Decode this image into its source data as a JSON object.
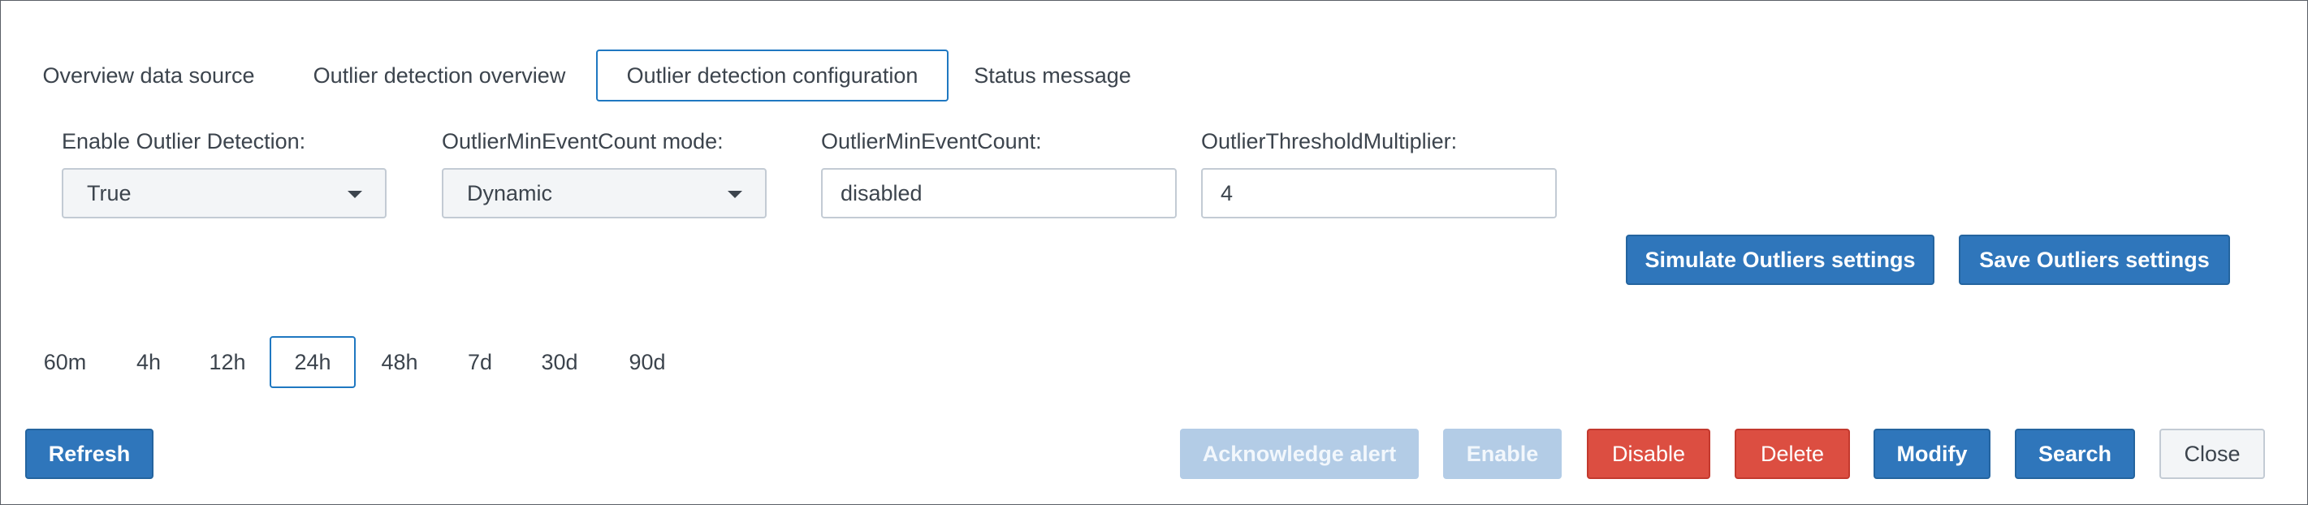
{
  "tabs": [
    {
      "label": "Overview data source",
      "active": false
    },
    {
      "label": "Outlier detection overview",
      "active": false
    },
    {
      "label": "Outlier detection configuration",
      "active": true
    },
    {
      "label": "Status message",
      "active": false
    }
  ],
  "config": {
    "enable_label": "Enable Outlier Detection:",
    "enable_value": "True",
    "mode_label": "OutlierMinEventCount mode:",
    "mode_value": "Dynamic",
    "min_count_label": "OutlierMinEventCount:",
    "min_count_value": "disabled",
    "threshold_label": "OutlierThresholdMultiplier:",
    "threshold_value": "4",
    "simulate_label": "Simulate Outliers settings",
    "save_label": "Save Outliers settings"
  },
  "time_ranges": [
    {
      "label": "60m",
      "active": false
    },
    {
      "label": "4h",
      "active": false
    },
    {
      "label": "12h",
      "active": false
    },
    {
      "label": "24h",
      "active": true
    },
    {
      "label": "48h",
      "active": false
    },
    {
      "label": "7d",
      "active": false
    },
    {
      "label": "30d",
      "active": false
    },
    {
      "label": "90d",
      "active": false
    }
  ],
  "actions": {
    "refresh": "Refresh",
    "acknowledge": "Acknowledge alert",
    "enable": "Enable",
    "disable": "Disable",
    "delete": "Delete",
    "modify": "Modify",
    "search": "Search",
    "close": "Close"
  },
  "colors": {
    "primary": "#2f76bb",
    "danger": "#dc4e41",
    "active_border": "#1f78c1"
  }
}
